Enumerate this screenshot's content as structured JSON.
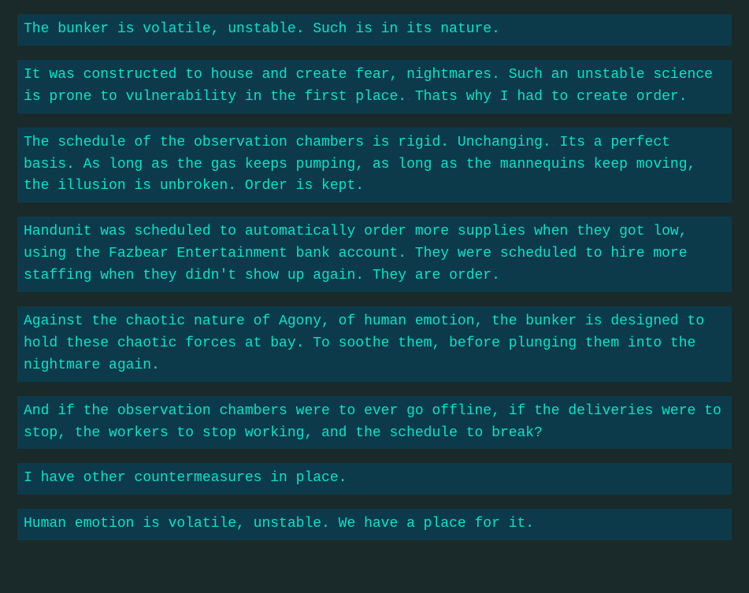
{
  "paragraphs": [
    {
      "id": "para1",
      "text": "The bunker is volatile, unstable. Such is in its nature."
    },
    {
      "id": "para2",
      "text": "It was constructed to house and create fear, nightmares. Such an unstable science is prone to vulnerability in the first place. Thats why I had to create order."
    },
    {
      "id": "para3",
      "text": "The schedule of the observation chambers is rigid. Unchanging. Its a perfect basis. As long as the gas keeps pumping, as long as the mannequins keep moving, the illusion is unbroken. Order is kept."
    },
    {
      "id": "para4",
      "text": "Handunit was scheduled to automatically order more supplies when they got low, using the Fazbear Entertainment bank account. They were scheduled to hire more staffing when they didn't show up again. They are order."
    },
    {
      "id": "para5",
      "text": "Against the chaotic nature of Agony, of human emotion, the bunker is designed to hold these chaotic forces at bay. To soothe them, before plunging them into the nightmare again."
    },
    {
      "id": "para6",
      "text": "And if the observation chambers were to ever go offline, if the deliveries were to stop, the workers to stop working, and the schedule to break?"
    },
    {
      "id": "para7",
      "text": "I have other countermeasures in place."
    },
    {
      "id": "para8",
      "text": "Human emotion is volatile, unstable. We have a place for it."
    }
  ]
}
